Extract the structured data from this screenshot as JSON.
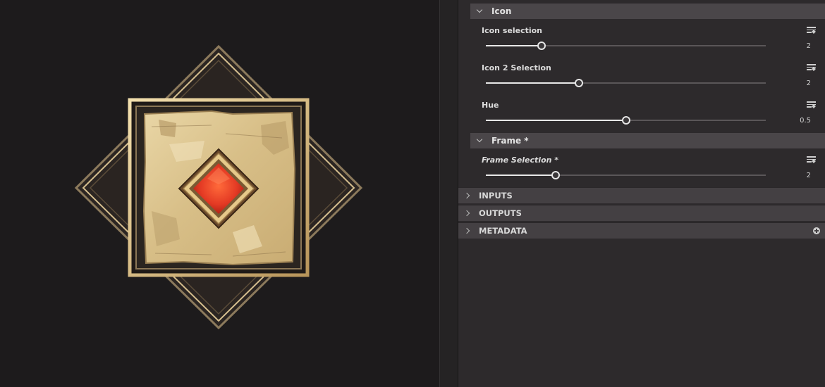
{
  "viewport": {
    "preview_name": "framed-icon-preview"
  },
  "panel": {
    "icon_group": {
      "title": "Icon",
      "properties": [
        {
          "label": "Icon selection",
          "value": "2",
          "level": 0.2
        },
        {
          "label": "Icon 2 Selection",
          "value": "2",
          "level": 0.333
        },
        {
          "label": "Hue",
          "value": "0.5",
          "level": 0.5
        }
      ]
    },
    "frame_group": {
      "title": "Frame *",
      "properties": [
        {
          "label": "Frame Selection *",
          "value": "2",
          "level": 0.25
        }
      ]
    },
    "sections": [
      {
        "title": "INPUTS"
      },
      {
        "title": "OUTPUTS"
      },
      {
        "title": "METADATA"
      }
    ]
  },
  "colors": {
    "panel_bg": "#2d2a2c",
    "group_header": "#4a4649",
    "gem_red": "#e8442a",
    "frame_gold": "#e6c98a"
  }
}
